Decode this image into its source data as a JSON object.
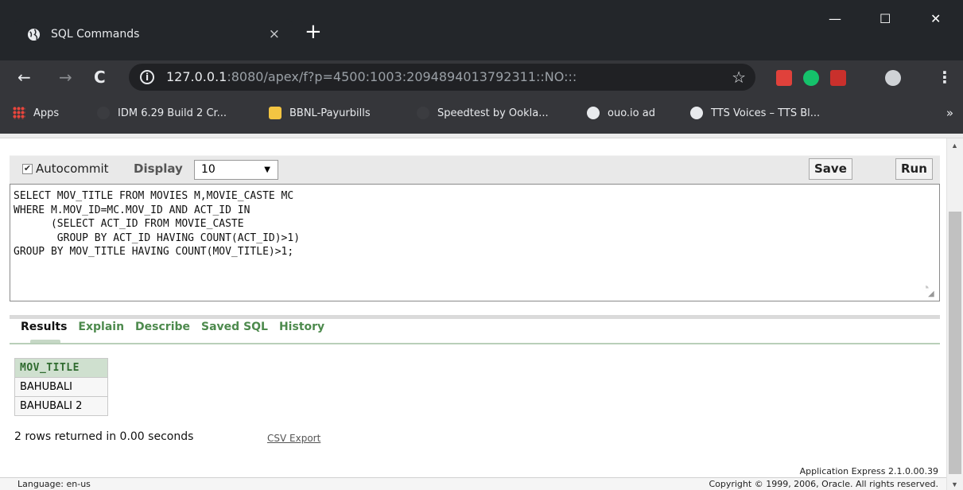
{
  "browser": {
    "tab_title": "SQL Commands",
    "tab_close": "×",
    "new_tab": "+",
    "window_controls": {
      "minimize": "—",
      "maximize": "☐",
      "close": "✕"
    },
    "nav": {
      "back": "←",
      "forward": "→",
      "reload": "C"
    },
    "url_host": "127.0.0.1",
    "url_rest": ":8080/apex/f?p=4500:1003:2094894013792311::NO:::",
    "bookmarks": [
      {
        "label": "Apps",
        "icon": "apps-grid-icon"
      },
      {
        "label": "IDM 6.29 Build 2 Cr...",
        "icon": "page-icon"
      },
      {
        "label": "BBNL-Payurbills",
        "icon": "bbnl-icon"
      },
      {
        "label": "Speedtest by Ookla...",
        "icon": "page-icon"
      },
      {
        "label": "ouo.io ad",
        "icon": "globe-icon"
      },
      {
        "label": "TTS Voices – TTS Bl...",
        "icon": "globe-icon"
      }
    ],
    "bookmarks_more": "»"
  },
  "sql_commands": {
    "autocommit_label": "Autocommit",
    "autocommit_checked": true,
    "display_label": "Display",
    "display_value": "10",
    "save_label": "Save",
    "run_label": "Run",
    "sql_text": "SELECT MOV_TITLE FROM MOVIES M,MOVIE_CASTE MC\nWHERE M.MOV_ID=MC.MOV_ID AND ACT_ID IN\n      (SELECT ACT_ID FROM MOVIE_CASTE\n       GROUP BY ACT_ID HAVING COUNT(ACT_ID)>1)\nGROUP BY MOV_TITLE HAVING COUNT(MOV_TITLE)>1;"
  },
  "result_tabs": [
    {
      "label": "Results",
      "active": true
    },
    {
      "label": "Explain",
      "active": false
    },
    {
      "label": "Describe",
      "active": false
    },
    {
      "label": "Saved SQL",
      "active": false
    },
    {
      "label": "History",
      "active": false
    }
  ],
  "results": {
    "columns": [
      "MOV_TITLE"
    ],
    "rows": [
      [
        "BAHUBALI"
      ],
      [
        "BAHUBALI 2"
      ]
    ],
    "row_count_text": "2 rows returned in 0.00 seconds",
    "csv_export_label": "CSV Export"
  },
  "footer": {
    "version": "Application Express 2.1.0.00.39",
    "language": "Language: en-us",
    "copyright": "Copyright © 1999, 2006, Oracle. All rights reserved."
  },
  "colors": {
    "chrome_dark": "#35363a",
    "tab_link_green": "#4d8a4d",
    "table_header_bg": "#cfe0cf"
  }
}
